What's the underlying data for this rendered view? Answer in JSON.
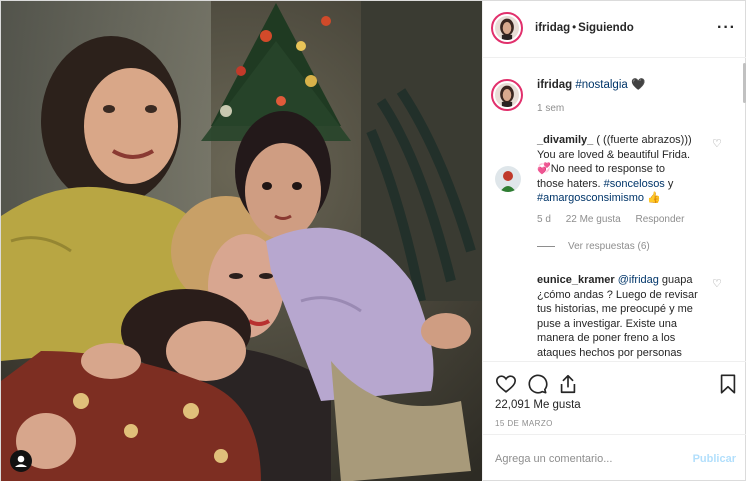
{
  "post": {
    "username": "ifridag",
    "follow_status": "Siguiendo",
    "separator": "•",
    "more_icon": "more-horizontal-icon",
    "caption": {
      "username": "ifridag",
      "hashtag": "#nostalgia",
      "emoji": "🖤",
      "time": "1 sem"
    },
    "comments": [
      {
        "username": "_divamily_",
        "lines": [
          {
            "text": "_divamily_ ( ((fuerte abrazos)))"
          },
          {
            "text": "You are loved & beautiful Frida."
          },
          {
            "text": "💞No need to response to"
          },
          {
            "text": "those haters. #soncelosos y"
          },
          {
            "text": "#amargosconsimismo 👍"
          }
        ],
        "time": "5 d",
        "likes": "22 Me gusta",
        "reply": "Responder",
        "view_replies": "Ver respuestas (6)"
      },
      {
        "username": "eunice_kramer",
        "lines": [
          {
            "text": "eunice_kramer @ifridag guapa"
          },
          {
            "text": "¿cómo andas ? Luego de revisar"
          },
          {
            "text": "tus historias, me preocupé y me"
          },
          {
            "text": "puse a investigar. Existe una"
          },
          {
            "text": "manera de poner freno a los"
          },
          {
            "text": "ataques hechos por personas"
          }
        ]
      }
    ],
    "likes_count": "22,091 Me gusta",
    "date": "15 DE MARZO",
    "add_comment_placeholder": "Agrega un comentario...",
    "publish_label": "Publicar",
    "colors": {
      "link": "#003569",
      "muted": "#8e8e8e",
      "publish_disabled": "#b2dffc",
      "story_ring": "#e1306c"
    }
  }
}
